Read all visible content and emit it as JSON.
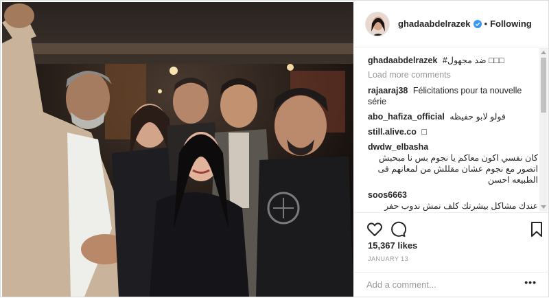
{
  "header": {
    "username": "ghadaabdelrazek",
    "separator": "•",
    "follow_status": "Following"
  },
  "comments": {
    "caption": {
      "user": "ghadaabdelrazek",
      "text": "#ضد مجهول □□□"
    },
    "load_more": "Load more comments",
    "items": [
      {
        "user": "rajaaraj38",
        "text": "Félicitations pour ta nouvelle série",
        "rtl": false
      },
      {
        "user": "abo_hafiza_official",
        "text": "فولو لابو حفيظه",
        "rtl": false
      },
      {
        "user": "still.alive.co",
        "text": "□",
        "rtl": false
      },
      {
        "user": "dwdw_elbasha",
        "text": "كان نفسي اكون معاكم يا نجوم بس نا مبحبش اتصور مع نجوم عشان مقللش من لمعانهم فى الطبيعه احسن",
        "rtl": true
      },
      {
        "user": "soos6663",
        "text": "عندك مشاكل بيشرتك كلف نمش ندوب حفر تصبغات حروق شمس حب شباب اثار حبوب جفاف خبريني مشكلتك بتعليق وانا بعطيكي الحل على الخاص",
        "rtl": true
      }
    ]
  },
  "actions": {
    "likes": "15,367 likes",
    "date": "JANUARY 13",
    "add_comment_placeholder": "Add a comment...",
    "options": "•••"
  },
  "icons": {
    "like": "heart-icon",
    "comment": "comment-bubble-icon",
    "save": "bookmark-icon",
    "verified": "verified-badge-icon"
  },
  "colors": {
    "verified": "#3897f0",
    "muted": "#999999",
    "text": "#262626"
  }
}
